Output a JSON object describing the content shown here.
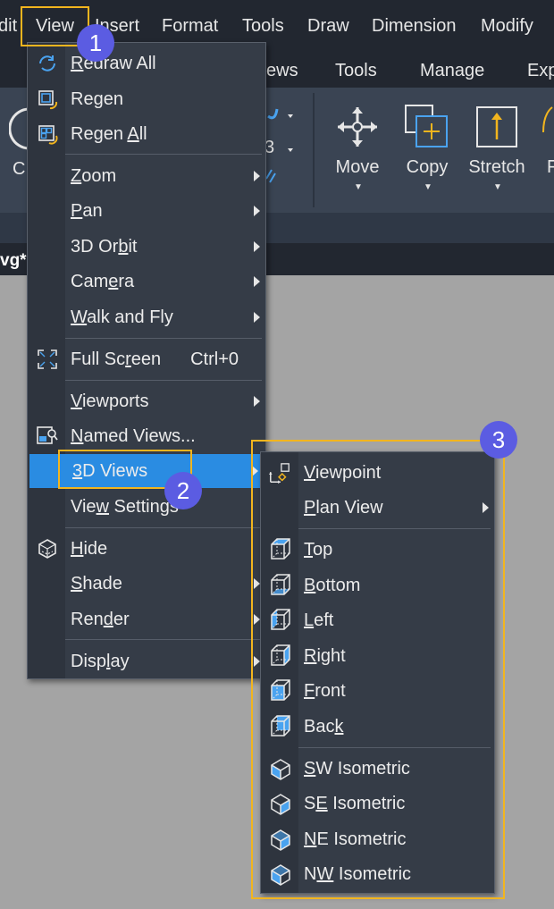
{
  "menubar": {
    "items": [
      "dit",
      "View",
      "Insert",
      "Format",
      "Tools",
      "Draw",
      "Dimension",
      "Modify"
    ]
  },
  "ribbon": {
    "tabs": [
      "ews",
      "Tools",
      "Manage",
      "Exp"
    ],
    "tools": [
      {
        "label": "Move",
        "icon": "move-icon"
      },
      {
        "label": "Copy",
        "icon": "copy-icon"
      },
      {
        "label": "Stretch",
        "icon": "stretch-icon"
      }
    ],
    "partial_left_label": "C",
    "partial_right_label": "F",
    "partial_small_label": "3"
  },
  "document": {
    "tab_label": "vg*"
  },
  "view_menu": {
    "items": [
      {
        "pre": "",
        "u": "R",
        "post": "edraw All",
        "icon": "redraw-icon"
      },
      {
        "pre": "Re",
        "u": "g",
        "post": "en",
        "icon": "regen-icon"
      },
      {
        "pre": "Regen ",
        "u": "A",
        "post": "ll",
        "icon": "regen-all-icon"
      },
      {
        "pre": "",
        "u": "Z",
        "post": "oom",
        "submenu": true
      },
      {
        "pre": "",
        "u": "P",
        "post": "an",
        "submenu": true
      },
      {
        "pre": "3D Or",
        "u": "b",
        "post": "it",
        "submenu": true
      },
      {
        "pre": "Cam",
        "u": "e",
        "post": "ra",
        "submenu": true
      },
      {
        "pre": "",
        "u": "W",
        "post": "alk and Fly",
        "submenu": true
      },
      {
        "pre": "Full Sc",
        "u": "r",
        "post": "een",
        "shortcut": "Ctrl+0",
        "icon": "fullscreen-icon"
      },
      {
        "pre": "",
        "u": "V",
        "post": "iewports",
        "submenu": true
      },
      {
        "pre": "",
        "u": "N",
        "post": "amed Views...",
        "icon": "named-views-icon"
      },
      {
        "pre": "",
        "u": "3",
        "post": "D Views",
        "submenu": true,
        "selected": true
      },
      {
        "pre": "Vie",
        "u": "w",
        "post": " Settings"
      },
      {
        "pre": "",
        "u": "H",
        "post": "ide",
        "icon": "hide-icon"
      },
      {
        "pre": "",
        "u": "S",
        "post": "hade",
        "submenu": true
      },
      {
        "pre": "Ren",
        "u": "d",
        "post": "er",
        "submenu": true
      },
      {
        "pre": "Disp",
        "u": "l",
        "post": "ay",
        "submenu": true
      }
    ]
  },
  "views3d_menu": {
    "items": [
      {
        "pre": "",
        "u": "V",
        "post": "iewpoint",
        "icon": "viewpoint-icon"
      },
      {
        "pre": "",
        "u": "P",
        "post": "lan View",
        "submenu": true
      },
      {
        "pre": "",
        "u": "T",
        "post": "op",
        "icon": "top-view-icon"
      },
      {
        "pre": "",
        "u": "B",
        "post": "ottom",
        "icon": "bottom-view-icon"
      },
      {
        "pre": "",
        "u": "L",
        "post": "eft",
        "icon": "left-view-icon"
      },
      {
        "pre": "",
        "u": "R",
        "post": "ight",
        "icon": "right-view-icon"
      },
      {
        "pre": "",
        "u": "F",
        "post": "ront",
        "icon": "front-view-icon"
      },
      {
        "pre": "Bac",
        "u": "k",
        "post": "",
        "icon": "back-view-icon"
      },
      {
        "pre": "",
        "u": "S",
        "post": "W Isometric",
        "icon": "sw-isometric-icon"
      },
      {
        "pre": "S",
        "u": "E",
        "post": " Isometric",
        "icon": "se-isometric-icon"
      },
      {
        "pre": "",
        "u": "N",
        "post": "E Isometric",
        "icon": "ne-isometric-icon"
      },
      {
        "pre": "N",
        "u": "W",
        "post": " Isometric",
        "icon": "nw-isometric-icon"
      }
    ]
  },
  "callouts": [
    "1",
    "2",
    "3"
  ],
  "colors": {
    "highlight": "#f2b51e",
    "badge": "#5b5ce2",
    "selected": "#2a8ce2"
  }
}
